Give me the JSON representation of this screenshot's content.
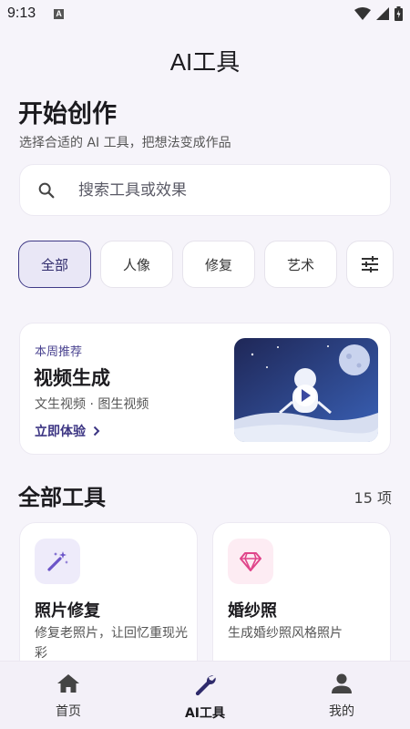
{
  "status_bar": {
    "time": "9:13",
    "notification_badge": "A"
  },
  "app_bar": {
    "title": "AI工具"
  },
  "header": {
    "heading": "开始创作",
    "subtitle": "选择合适的 AI 工具，把想法变成作品"
  },
  "search": {
    "placeholder": "搜索工具或效果",
    "icon": "search-icon"
  },
  "chips": [
    {
      "label": "全部",
      "active": true
    },
    {
      "label": "人像",
      "active": false
    },
    {
      "label": "修复",
      "active": false
    },
    {
      "label": "艺术",
      "active": false
    }
  ],
  "filter_icon": "tune-icon",
  "featured": {
    "eyebrow": "本周推荐",
    "title": "视频生成",
    "description": "文生视频 · 图生视频",
    "cta": "立即体验",
    "cta_icon": "chevron-right-icon"
  },
  "tools_section": {
    "title": "全部工具",
    "count": "15 项"
  },
  "tools": [
    {
      "title": "照片修复",
      "description": "修复老照片，让回忆重现光彩",
      "icon": "magic-wand-icon",
      "icon_bg": "#eeebfa",
      "icon_color": "#6b54c8"
    },
    {
      "title": "婚纱照",
      "description": "生成婚纱照风格照片",
      "icon": "diamond-icon",
      "icon_bg": "#fdecf3",
      "icon_color": "#e0458a"
    }
  ],
  "bottom_nav": [
    {
      "label": "首页",
      "icon": "home-icon",
      "active": false
    },
    {
      "label": "AI工具",
      "icon": "wrench-icon",
      "active": true
    },
    {
      "label": "我的",
      "icon": "person-icon",
      "active": false
    }
  ],
  "colors": {
    "accent": "#3f3a86",
    "background": "#f6f4fa",
    "card": "#ffffff"
  }
}
